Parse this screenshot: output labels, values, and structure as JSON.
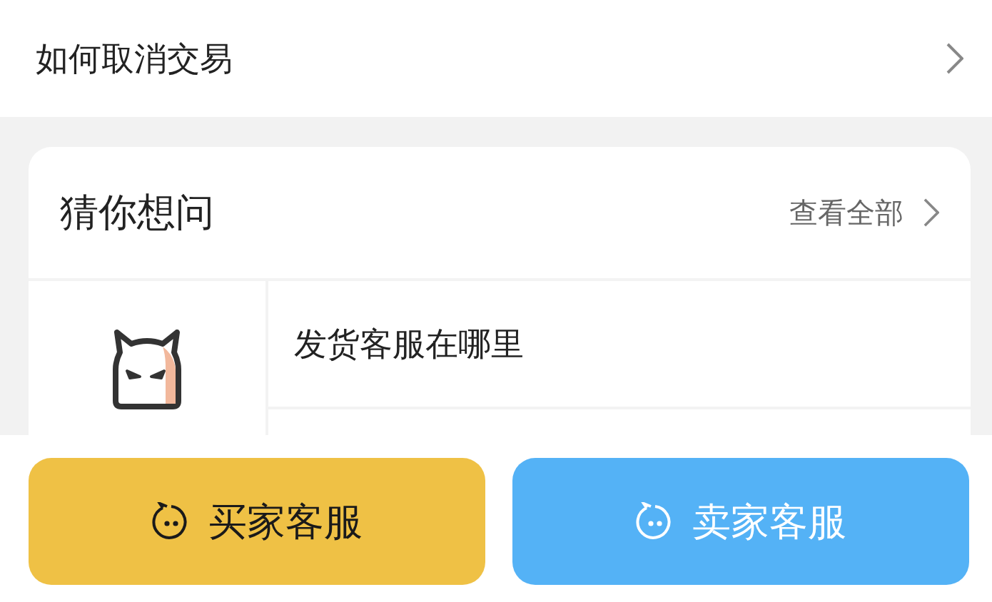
{
  "top_item": {
    "label": "如何取消交易"
  },
  "faq_card": {
    "title": "猜你想问",
    "view_all": "查看全部",
    "questions": [
      {
        "text": "发货客服在哪里"
      }
    ]
  },
  "buttons": [
    {
      "kind": "buyer",
      "label": "买家客服"
    },
    {
      "kind": "seller",
      "label": "卖家客服"
    }
  ]
}
